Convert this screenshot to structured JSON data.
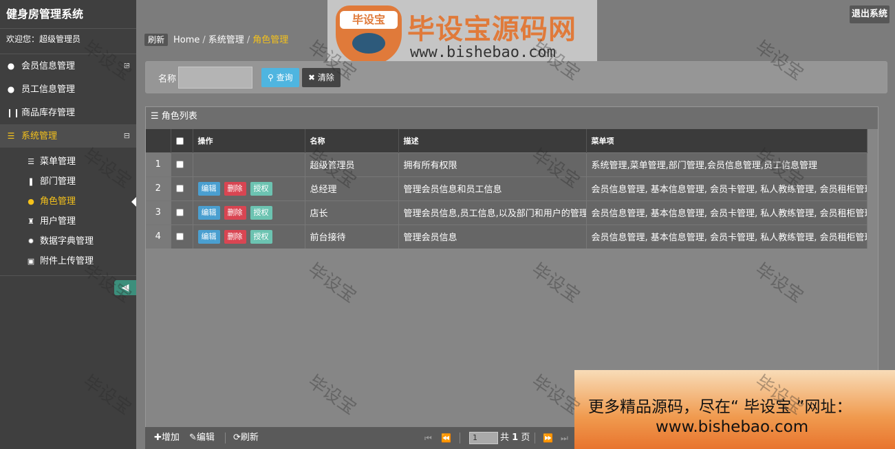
{
  "app": {
    "title": "健身房管理系统",
    "welcome": "欢迎您：超级管理员"
  },
  "topbar": {
    "logout": "退出系统"
  },
  "logo": {
    "badge": "毕设宝",
    "title": "毕设宝源码网",
    "url": "www.bishebao.com"
  },
  "sidebar": {
    "items": [
      {
        "label": "会员信息管理",
        "icon": "user-icon",
        "toggle": "⊞"
      },
      {
        "label": "员工信息管理",
        "icon": "user-icon"
      },
      {
        "label": "商品库存管理",
        "icon": "cutlery-icon"
      },
      {
        "label": "系统管理",
        "icon": "list-icon",
        "toggle": "⊟"
      }
    ],
    "sub_items": [
      {
        "label": "菜单管理",
        "icon": "menu-icon"
      },
      {
        "label": "部门管理",
        "icon": "columns-icon"
      },
      {
        "label": "角色管理",
        "icon": "user-icon"
      },
      {
        "label": "用户管理",
        "icon": "tower-icon"
      },
      {
        "label": "数据字典管理",
        "icon": "gear-icon"
      },
      {
        "label": "附件上传管理",
        "icon": "briefcase-icon"
      }
    ]
  },
  "breadcrumb": {
    "refresh": "刷新",
    "home": "Home",
    "section": "系统管理",
    "current": "角色管理",
    "sep": "/"
  },
  "search": {
    "label": "名称",
    "value": "",
    "query_btn": "查询",
    "clear_btn": "清除"
  },
  "table": {
    "title": "角色列表",
    "columns": [
      "",
      "",
      "操作",
      "名称",
      "描述",
      "菜单项"
    ],
    "op_labels": {
      "edit": "编辑",
      "delete": "删除",
      "auth": "授权"
    },
    "rows": [
      {
        "num": "1",
        "has_ops": false,
        "name": "超级管理员",
        "desc": "拥有所有权限",
        "menus": "系统管理,菜单管理,部门管理,会员信息管理,员工信息管理"
      },
      {
        "num": "2",
        "has_ops": true,
        "name": "总经理",
        "desc": "管理会员信息和员工信息",
        "menus": "会员信息管理, 基本信息管理, 会员卡管理, 私人教练管理, 会员租柜管理,"
      },
      {
        "num": "3",
        "has_ops": true,
        "name": "店长",
        "desc": "管理会员信息,员工信息,以及部门和用户的管理",
        "menus": "会员信息管理, 基本信息管理, 会员卡管理, 私人教练管理, 会员租柜管理,"
      },
      {
        "num": "4",
        "has_ops": true,
        "name": "前台接待",
        "desc": "管理会员信息",
        "menus": "会员信息管理, 基本信息管理, 会员卡管理, 私人教练管理, 会员租柜管理"
      }
    ]
  },
  "footer": {
    "add": "增加",
    "edit": "编辑",
    "refresh": "刷新",
    "page_value": "1",
    "total_prefix": "共",
    "total_pages": "1",
    "total_suffix": "页"
  },
  "ad": {
    "line1": "更多精品源码，尽在“ 毕设宝 ”网址：",
    "line2": "www.bishebao.com"
  },
  "watermark": "毕设宝"
}
